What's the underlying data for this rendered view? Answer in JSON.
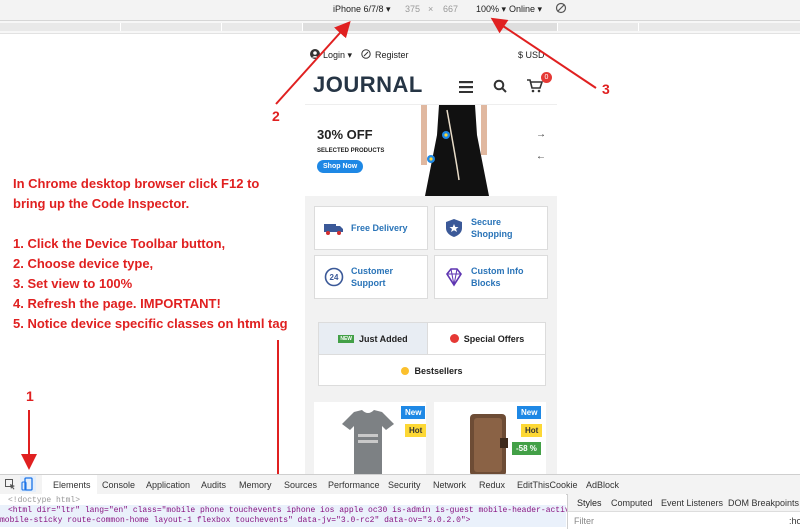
{
  "device_toolbar": {
    "device": "iPhone 6/7/8",
    "width": "375",
    "times": "×",
    "height": "667",
    "zoom": "100%",
    "network": "Online"
  },
  "site": {
    "login": "Login",
    "register": "Register",
    "currency": "$ USD",
    "logo": "JOURNAL",
    "cart_count": "0",
    "hero_title": "30% OFF",
    "hero_sub": "SELECTED PRODUCTS",
    "hero_button": "Shop Now",
    "features": [
      {
        "line1": "Free Delivery",
        "line2": ""
      },
      {
        "line1": "Secure",
        "line2": "Shopping"
      },
      {
        "line1": "Customer",
        "line2": "Support"
      },
      {
        "line1": "Custom Info",
        "line2": "Blocks"
      }
    ],
    "tabs": {
      "just_added": "Just Added",
      "special_offers": "Special Offers",
      "bestsellers": "Bestsellers",
      "new_icon_text": "NEW"
    },
    "products": [
      {
        "badges": [
          "New",
          "Hot"
        ]
      },
      {
        "badges": [
          "New",
          "Hot",
          "-58 %"
        ]
      }
    ]
  },
  "instructions": {
    "line1": "In Chrome desktop browser click F12 to",
    "line2": "bring up the Code Inspector.",
    "step1": "1. Click the Device Toolbar button,",
    "step2": "2. Choose device type,",
    "step3": "3. Set view to 100%",
    "step4": "4. Refresh the page. IMPORTANT!",
    "step5": "5. Notice device specific classes on html tag"
  },
  "callouts": {
    "one": "1",
    "two": "2",
    "three": "3"
  },
  "devtools": {
    "tabs": [
      "Elements",
      "Console",
      "Application",
      "Audits",
      "Memory",
      "Sources",
      "Performance",
      "Security",
      "Network",
      "Redux",
      "EditThisCookie",
      "AdBlock"
    ],
    "doctype": "<!doctype html>",
    "html_line": "<html dir=\"ltr\" lang=\"en\" class=\"mobile phone touchevents iphone ios apple oc30 is-admin is-guest mobile-header-active",
    "html_line2": "mobile-sticky route-common-home layout-1 flexbox touchevents\" data-jv=\"3.0-rc2\" data-ov=\"3.0.2.0\">",
    "side_tabs": [
      "Styles",
      "Computed",
      "Event Listeners",
      "DOM Breakpoints"
    ],
    "filter_placeholder": "Filter",
    "hov": ":ho"
  },
  "colors": {
    "accent_red": "#e02020",
    "link_blue": "#2a74b8",
    "logo": "#263545"
  }
}
